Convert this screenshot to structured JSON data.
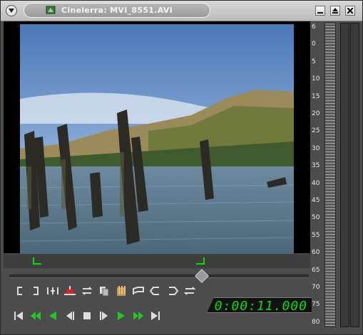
{
  "window": {
    "title": "Cinelerra: MVI_8551.AVI",
    "colors": {
      "frame": "#4c4c4c",
      "title_bg": "#bcbcbc",
      "accent_green": "#00dd00"
    }
  },
  "timecode": "0:00:11.000",
  "meter": {
    "labels": [
      "6",
      "0",
      "5",
      "10",
      "15",
      "20",
      "25",
      "30",
      "35",
      "40",
      "45",
      "50",
      "55",
      "60",
      "65",
      "70",
      "75",
      "80"
    ]
  },
  "icons": {
    "window": [
      "menu-arrow-icon",
      "app-icon",
      "minimize-icon",
      "maximize-icon",
      "close-icon"
    ],
    "edit_toolbar": [
      "in-point-icon",
      "out-point-icon",
      "splice-icon",
      "overwrite-icon",
      "to-clip-icon",
      "copy-icon",
      "paste-icon",
      "label-icon",
      "prev-label-icon",
      "next-label-icon",
      "cycle-icon"
    ],
    "transport": [
      "rewind-to-start-icon",
      "fast-reverse-icon",
      "reverse-icon",
      "frame-back-icon",
      "stop-icon",
      "frame-forward-icon",
      "play-icon",
      "fast-forward-icon",
      "end-icon"
    ]
  }
}
